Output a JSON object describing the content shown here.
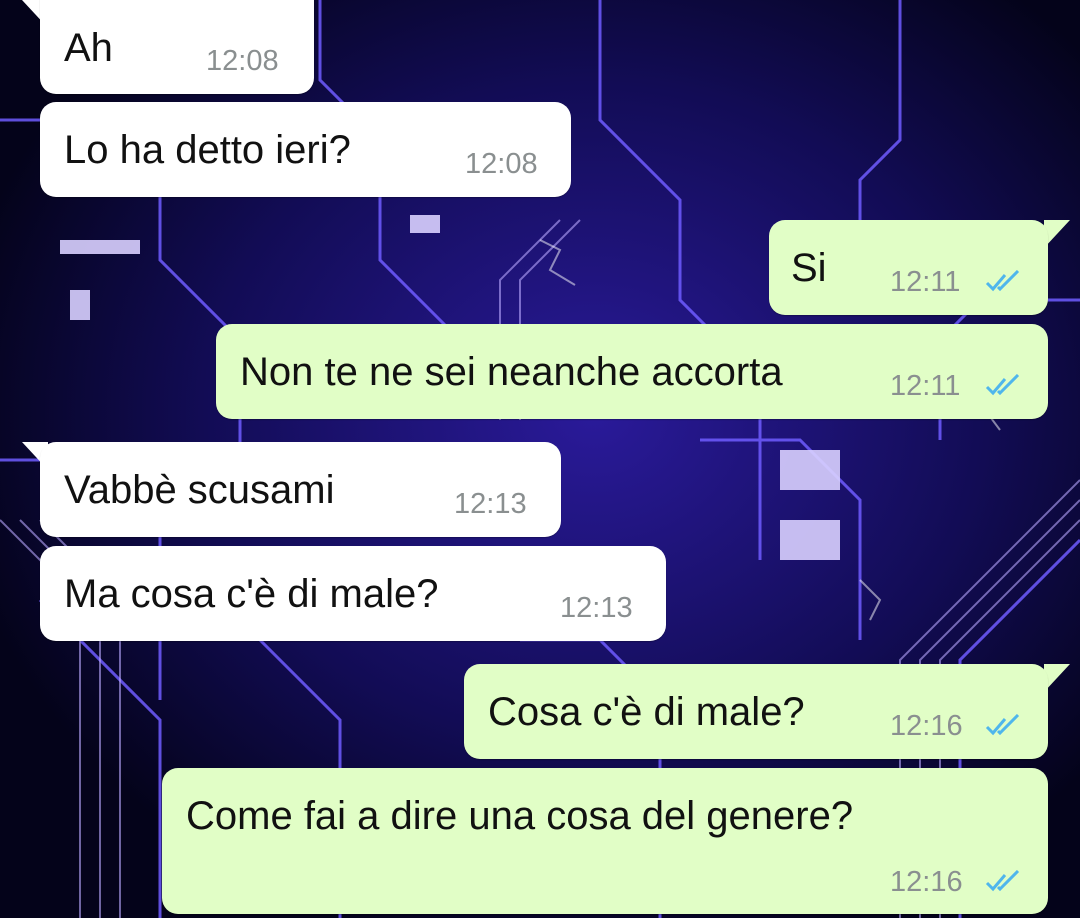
{
  "chat": {
    "messages": [
      {
        "direction": "incoming",
        "text": "Ah",
        "time": "12:08"
      },
      {
        "direction": "incoming",
        "text": "Lo ha detto ieri?",
        "time": "12:08"
      },
      {
        "direction": "outgoing",
        "text": "Si",
        "time": "12:11",
        "status": "read"
      },
      {
        "direction": "outgoing",
        "text": "Non te ne sei neanche accorta",
        "time": "12:11",
        "status": "read"
      },
      {
        "direction": "incoming",
        "text": "Vabbè scusami",
        "time": "12:13"
      },
      {
        "direction": "incoming",
        "text": "Ma cosa c'è di male?",
        "time": "12:13"
      },
      {
        "direction": "outgoing",
        "text": "Cosa c'è di male?",
        "time": "12:16",
        "status": "read"
      },
      {
        "direction": "outgoing",
        "text": "Come fai a dire una cosa del genere?",
        "time": "12:16",
        "status": "read"
      }
    ]
  },
  "theme": {
    "incoming_bubble": "#ffffff",
    "outgoing_bubble": "#e1fec6",
    "read_tick_color": "#4fb6ec",
    "wallpaper": "blue circuit board"
  },
  "icons": {
    "read_receipt": "double-check-icon"
  }
}
